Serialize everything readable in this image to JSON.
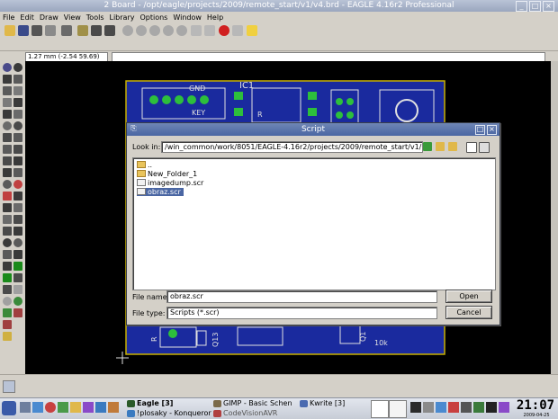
{
  "window": {
    "title": "2 Board - /opt/eagle/projects/2009/remote_start/v1/v4.brd - EAGLE 4.16r2 Professional"
  },
  "menu": [
    "File",
    "Edit",
    "Draw",
    "View",
    "Tools",
    "Library",
    "Options",
    "Window",
    "Help"
  ],
  "coords": "1.27 mm (-2.54 59.69)",
  "board": {
    "labels": {
      "gnd": "GND",
      "key": "KEY",
      "ic1": "IC1",
      "r": "R",
      "q1": "Q1",
      "q13": "Q13",
      "r10k": "10k"
    }
  },
  "dialog": {
    "title": "Script",
    "look_in_label": "Look in:",
    "look_in_value": "/win_common/work/8051/EAGLE-4.16r2/projects/2009/remote_start/v1/",
    "files": [
      {
        "name": "..",
        "kind": "folder"
      },
      {
        "name": "New_Folder_1",
        "kind": "folder"
      },
      {
        "name": "imagedump.scr",
        "kind": "file"
      },
      {
        "name": "obraz.scr",
        "kind": "file",
        "selected": true
      }
    ],
    "file_name_label": "File name:",
    "file_name_value": "obraz.scr",
    "file_type_label": "File type:",
    "file_type_value": "Scripts (*.scr)",
    "open_label": "Open",
    "cancel_label": "Cancel"
  },
  "taskbar": {
    "tasks": [
      {
        "label": "Eagle [3]",
        "bold": true
      },
      {
        "label": "GIMP - Basic Schen"
      },
      {
        "label": "Kwrite [3]"
      },
      {
        "label": "!plosaky - Konqueror"
      },
      {
        "label": "CodeVisionAVR"
      }
    ],
    "time": "21:07",
    "date": "2009-04-25"
  },
  "colors": {
    "canvas": "#000000",
    "board": "#1a2a9e",
    "pad": "#2dbf3c",
    "selection": "#4a66a3"
  }
}
